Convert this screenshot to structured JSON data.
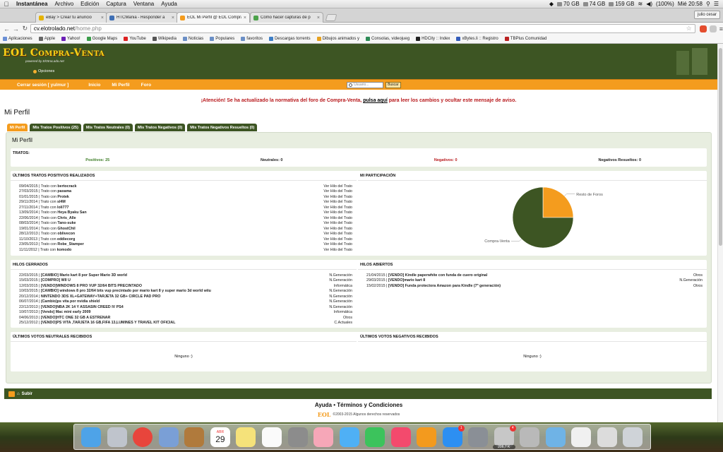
{
  "menubar": {
    "app": "Instantánea",
    "menus": [
      "Archivo",
      "Edición",
      "Captura",
      "Ventana",
      "Ayuda"
    ],
    "disks": [
      "70 GB",
      "74 GB",
      "159 GB"
    ],
    "battery": "(100%)",
    "clock": "Mié 20:58"
  },
  "tabs": [
    {
      "title": "eBay > Crear tu anuncio",
      "color": "#e5b300"
    },
    {
      "title": "HTCMania - Responder a",
      "color": "#3f6fb4"
    },
    {
      "title": "EOL Mi Perfil @ EOL Compra-V",
      "color": "#f49c1e"
    },
    {
      "title": "Cómo hacer capturas de p",
      "color": "#4ca24a"
    }
  ],
  "browser": {
    "user": "julio cesar",
    "url_host": "cv.elotrolado.net",
    "url_path": "/home.php"
  },
  "bookmarks": [
    {
      "label": "Aplicaciones",
      "color": "#6a8fd6"
    },
    {
      "label": "Apple",
      "color": "#666"
    },
    {
      "label": "Yahoo!",
      "color": "#6b1fb6"
    },
    {
      "label": "Google Maps",
      "color": "#3a9d4a"
    },
    {
      "label": "YouTube",
      "color": "#d22"
    },
    {
      "label": "Wikipedia",
      "color": "#555"
    },
    {
      "label": "Noticias",
      "color": "#6b8fc6"
    },
    {
      "label": "Populares",
      "color": "#6b8fc6"
    },
    {
      "label": "favoritos",
      "color": "#6b8fc6"
    },
    {
      "label": "Descargas torrents",
      "color": "#3e7ec5"
    },
    {
      "label": "Dibujos animados y",
      "color": "#e7a21f"
    },
    {
      "label": "Consolas, videojueg",
      "color": "#2e8b57"
    },
    {
      "label": "HDCity :: Index",
      "color": "#222"
    },
    {
      "label": "xBytes.li :: Registro",
      "color": "#345dbb"
    },
    {
      "label": "TBPlus Comunidad",
      "color": "#b22"
    }
  ],
  "site": {
    "logo": "EOL Compra-Venta",
    "logo_sub": "powered by ElOtroLado.net",
    "opciones": "Opciones",
    "nav": [
      "Cerrar sesión [ yulmur ]",
      "Inicio",
      "Mi Perfil",
      "Foro"
    ],
    "search_placeholder": "Usuario...",
    "search_button": "Buscar"
  },
  "alert": {
    "before": "¡Atención! Se ha actualizado la normativa del foro de Compra-Venta,",
    "link": "pulsa aquí",
    "after": "para leer los cambios y ocultar este mensaje de aviso."
  },
  "page_title": "Mi Perfil",
  "profile_tabs": [
    "Mi Perfil",
    "Mis Tratos Positivos (25)",
    "Mis Tratos Neutrales (0)",
    "Mis Tratos Negativos (0)",
    "Mis Tratos Negativos Resueltos (0)"
  ],
  "container_title": "Mi Perfil",
  "tratos": {
    "label": "Tratos:",
    "positivos": "Positivos: 25",
    "neutrales": "Neutrales: 0",
    "negativos": "Negativos: 0",
    "resueltos": "Negativos Resueltos: 0"
  },
  "ultimos_tratos": {
    "label": "Últimos tratos positivos realizados",
    "rows": [
      {
        "date": "09/04/2015",
        "user": "bertocrack",
        "link": "Ver Hilo del Trato"
      },
      {
        "date": "27/03/2015",
        "user": "paxama",
        "link": "Ver Hilo del Trato"
      },
      {
        "date": "01/01/2015",
        "user": "Protek",
        "link": "Ver Hilo del Trato"
      },
      {
        "date": "29/11/2014",
        "user": "sl4M",
        "link": "Ver Hilo del Trato"
      },
      {
        "date": "27/11/2014",
        "user": "loli777",
        "link": "Ver Hilo del Trato"
      },
      {
        "date": "13/09/2014",
        "user": "Heya Byaku San",
        "link": "Ver Hilo del Trato"
      },
      {
        "date": "22/06/2014",
        "user": "Chris_Alle",
        "link": "Ver Hilo del Trato"
      },
      {
        "date": "08/03/2014",
        "user": "Tano-suke",
        "link": "Ver Hilo del Trato"
      },
      {
        "date": "19/01/2014",
        "user": "GhostChil",
        "link": "Ver Hilo del Trato"
      },
      {
        "date": "28/12/2013",
        "user": "oblivecon",
        "link": "Ver Hilo del Trato"
      },
      {
        "date": "11/10/2013",
        "user": "eddiecorg",
        "link": "Ver Hilo del Trato"
      },
      {
        "date": "23/05/2013",
        "user": "Robe_Stamper",
        "link": "Ver Hilo del Trato"
      },
      {
        "date": "11/11/2012",
        "user": "komodo",
        "link": "Ver Hilo del Trato"
      }
    ],
    "trato_con": "Trato con"
  },
  "participacion": {
    "label": "Mi participación",
    "slices": [
      {
        "name": "Resto de Foros",
        "value": 25,
        "color": "#f49c1e"
      },
      {
        "name": "Compra-Venta",
        "value": 75,
        "color": "#3d5523"
      }
    ]
  },
  "hilos_cerrados": {
    "label": "Hilos cerrados",
    "rows": [
      {
        "date": "22/03/2015",
        "title": "[CAMBIO] Mario kart 8 por Super Mario 3D world",
        "cat": "N.Generación"
      },
      {
        "date": "15/03/2015",
        "title": "[COMPRO] WII U",
        "cat": "N.Generación"
      },
      {
        "date": "12/03/2015",
        "title": "[VENDO]WINDOWS 8 PRO VUP 32/64 BITS PRECINTADO",
        "cat": "Informática"
      },
      {
        "date": "10/03/2015",
        "title": "[CAMBIO] windows 8 pro 32/64 bits vup precintado por mario kart 8 y super mario 3d world wiiu",
        "cat": "N.Generación"
      },
      {
        "date": "20/12/2014",
        "title": "NINTENDO 3DS XL+GATEWAY+TARJETA 32 GB+ CIRCLE PAD PRO",
        "cat": "N.Generación"
      },
      {
        "date": "06/07/2014",
        "title": "(Cambio)ps vita por nvidia shield",
        "cat": "N.Generación"
      },
      {
        "date": "22/12/2013",
        "title": "[VENDO]NBA 2K 14 Y ASSASIN CREED IV PS4",
        "cat": "N.Generación"
      },
      {
        "date": "10/07/2013",
        "title": "[Vendo] Mac mini early 2009",
        "cat": "Informática"
      },
      {
        "date": "04/06/2013",
        "title": "[VENDO]HTC ONE 32 GB A ESTRENAR",
        "cat": "Otros"
      },
      {
        "date": "25/12/2012",
        "title": "[VENDO]PS VITA ,TARJETA 16 GB,FIFA 13,LUMINES Y TRAVEL KIT OFICIAL",
        "cat": "C.Actuales"
      }
    ]
  },
  "hilos_abiertos": {
    "label": "Hilos abiertos",
    "rows": [
      {
        "date": "21/04/2015",
        "title": "[VENDO] Kindle paperwhite con funda de cuero original",
        "cat": "Otros"
      },
      {
        "date": "29/03/2015",
        "title": "[VENDO]mario kart 8",
        "cat": "N.Generación"
      },
      {
        "date": "15/02/2015",
        "title": "[VENDO] Funda protectora Amazon para Kindle (7ª generación)",
        "cat": "Otros"
      }
    ]
  },
  "votos_neutrales": {
    "label": "Últimos votos neutrales recibidos",
    "empty": "Ninguno :)"
  },
  "votos_negativos": {
    "label": "Últimos votos negativos recibidos",
    "empty": "Ninguno :)"
  },
  "subir": "Subir",
  "footer": {
    "links": "Ayuda • Términos y Condiciones",
    "brand": "EOL",
    "copy": "©2003-2015 Algunos derechos reservados"
  },
  "dock": {
    "icons": [
      {
        "name": "finder-icon",
        "color": "#4ea3e8"
      },
      {
        "name": "launchpad-icon",
        "color": "#bfc4cc"
      },
      {
        "name": "chrome-icon",
        "color": "#e8453c"
      },
      {
        "name": "preview-icon",
        "color": "#7a9fd6"
      },
      {
        "name": "contacts-icon",
        "color": "#b07a3c"
      },
      {
        "name": "calendar-icon",
        "color": "#ffffff"
      },
      {
        "name": "notes-icon",
        "color": "#f5e27a"
      },
      {
        "name": "reminders-icon",
        "color": "#fafafa"
      },
      {
        "name": "photo-booth-icon",
        "color": "#8c8c8c"
      },
      {
        "name": "photos-icon",
        "color": "#f6a7b8"
      },
      {
        "name": "messages-icon",
        "color": "#4fb0f5"
      },
      {
        "name": "facetime-icon",
        "color": "#3cc35c"
      },
      {
        "name": "itunes-icon",
        "color": "#f34a6d"
      },
      {
        "name": "ibooks-icon",
        "color": "#f39a1e"
      },
      {
        "name": "app-store-icon",
        "color": "#2d8ff2"
      },
      {
        "name": "system-preferences-icon",
        "color": "#8a8f96"
      },
      {
        "name": "transmission-icon",
        "color": "#c7c7c7"
      },
      {
        "name": "screenshot-icon",
        "color": "#b9b9b9"
      },
      {
        "name": "folder-icon",
        "color": "#6fb3e6"
      },
      {
        "name": "document-icon",
        "color": "#f0f0f0"
      },
      {
        "name": "stack-icon",
        "color": "#dcdcdc"
      },
      {
        "name": "trash-icon",
        "color": "#cfd3d8"
      }
    ],
    "calendar_month": "ABR",
    "calendar_day": "29",
    "app_store_badge": "1",
    "transmission_badge": "4",
    "transmission_label": "206,7 K"
  }
}
